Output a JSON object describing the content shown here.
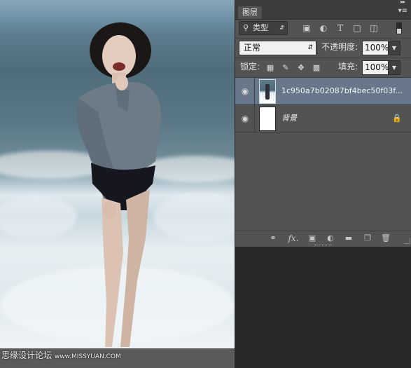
{
  "canvas": {
    "watermark": "思缘设计论坛",
    "watermark_url": "www.MISSYUAN.COM"
  },
  "panel": {
    "collapse_icon": "double-chevron-right-icon",
    "tab_label": "图层",
    "menu_icon": "panel-menu-icon",
    "filter": {
      "kind_label": "类型",
      "icons": [
        "image-filter-icon",
        "adjustment-filter-icon",
        "type-filter-icon",
        "shape-filter-icon",
        "smart-object-filter-icon"
      ]
    },
    "blend_mode": "正常",
    "opacity_label": "不透明度:",
    "opacity_value": "100%",
    "lock_label": "锁定:",
    "lock_icons": [
      "lock-transparent-icon",
      "lock-pixels-icon",
      "lock-position-icon",
      "lock-all-icon"
    ],
    "fill_label": "填充:",
    "fill_value": "100%",
    "layers": [
      {
        "name": "1c950a7b02087bf4bec50f03f...",
        "visible": true,
        "selected": true,
        "locked": false
      },
      {
        "name": "背景",
        "visible": true,
        "selected": false,
        "locked": true
      }
    ],
    "footer_icons": [
      "link-layers-icon",
      "fx-icon",
      "add-mask-icon",
      "adjustment-layer-icon",
      "new-group-icon",
      "new-layer-icon",
      "delete-layer-icon"
    ]
  }
}
